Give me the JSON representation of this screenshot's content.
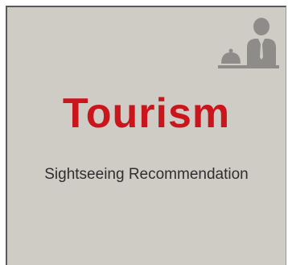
{
  "tile": {
    "title": "Tourism",
    "subtitle": "Sightseeing Recommendation",
    "icon": "concierge-bell-person-icon",
    "colors": {
      "background": "#cfccc6",
      "title": "#c9151b",
      "subtitle": "#2e2e2e",
      "icon": "#8e8c88"
    }
  }
}
